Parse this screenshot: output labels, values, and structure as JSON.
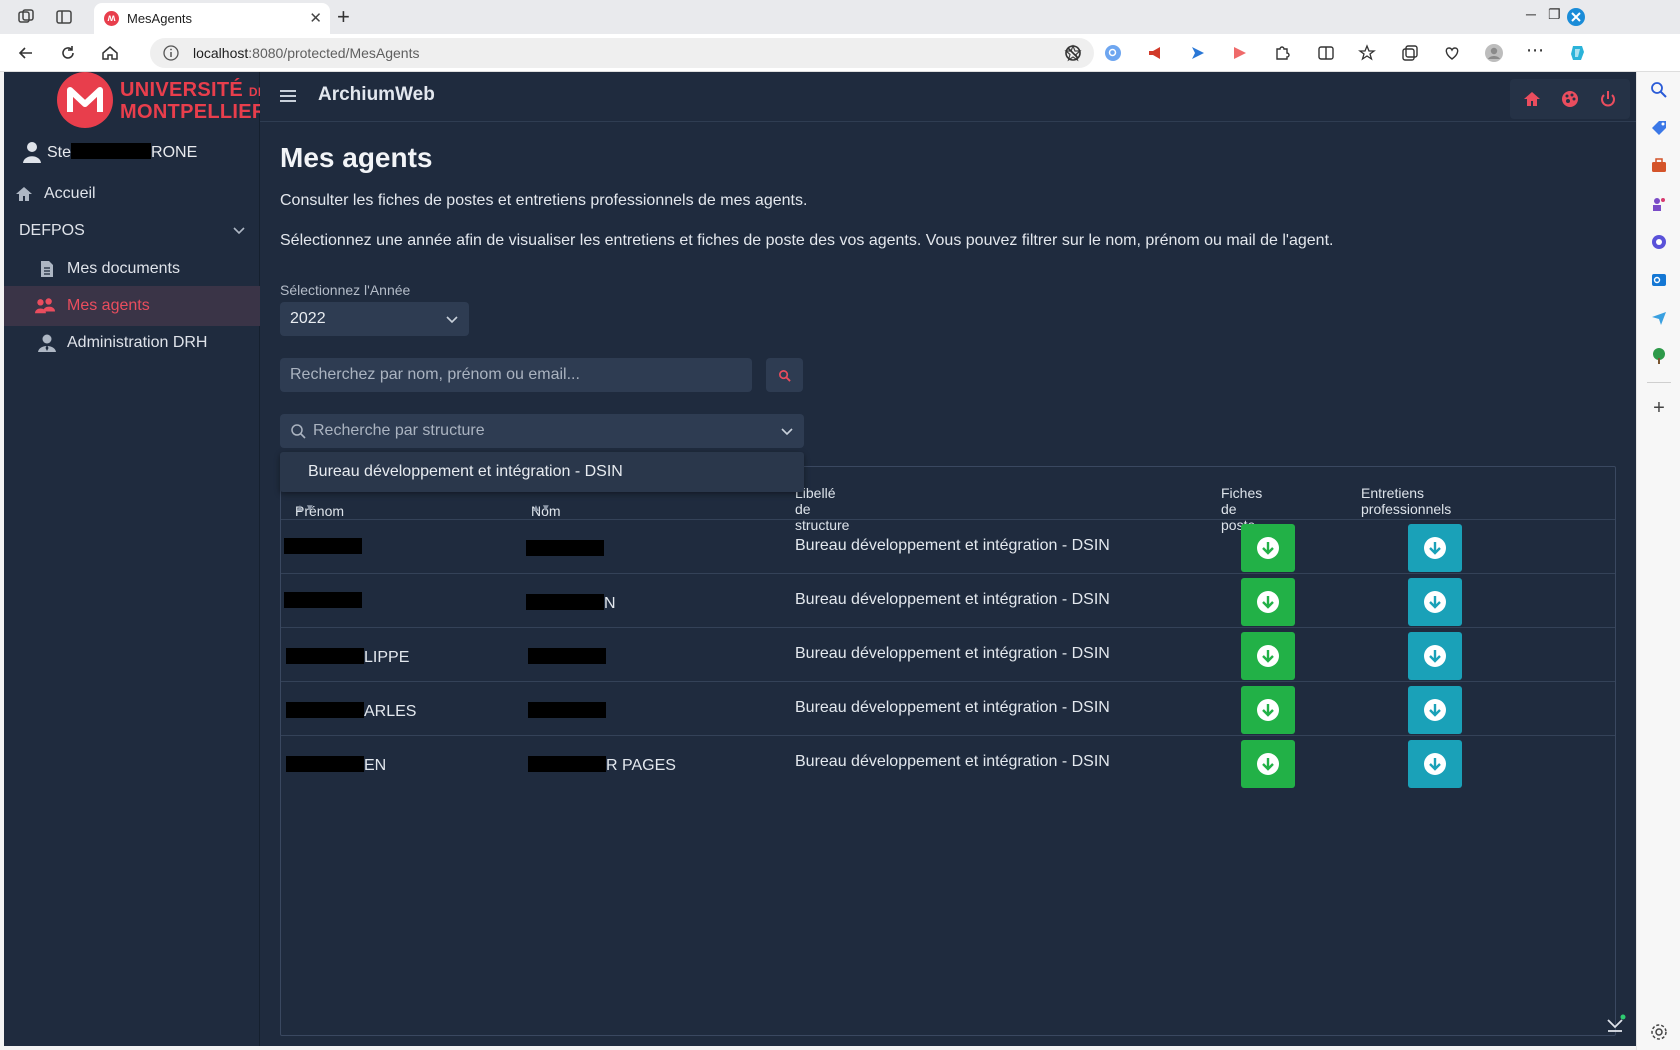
{
  "browser": {
    "tab_title": "MesAgents",
    "tab_favicon": "ʍ",
    "url_host": "localhost",
    "url_rest": ":8080/protected/MesAgents"
  },
  "app": {
    "logo": {
      "line1": "UNIVERSITÉ",
      "line1_suffix": "DE",
      "line2": "MONTPELLIER",
      "mark": "ʍ"
    },
    "user": {
      "name_start": "Ste",
      "name_end": "RONE"
    },
    "sidebar": {
      "home": "Accueil",
      "section": "DEFPOS",
      "items": [
        {
          "label": "Mes documents",
          "icon": "document-icon"
        },
        {
          "label": "Mes agents",
          "icon": "agents-icon",
          "active": true
        },
        {
          "label": "Administration DRH",
          "icon": "admin-user-icon"
        }
      ]
    },
    "topbar": {
      "title": "ArchiumWeb"
    }
  },
  "page": {
    "title": "Mes agents",
    "intro": "Consulter les fiches de postes et entretiens professionnels de mes agents.",
    "instructions": "Sélectionnez une année afin de visualiser les entretiens et fiches de poste des vos agents. Vous pouvez filtrer sur le nom, prénom ou mail de l'agent.",
    "year_label": "Sélectionnez l'Année",
    "year_value": "2022",
    "search_placeholder": "Recherchez par nom, prénom ou email...",
    "structure_placeholder": "Recherche par structure",
    "structure_option": "Bureau développement et intégration - DSIN"
  },
  "table": {
    "headers": {
      "prenom": "Prénom",
      "nom": "Nom",
      "structure": "Libellé de structure",
      "fiches": "Fiches de poste",
      "entretiens": "Entretiens professionnels"
    },
    "rows": [
      {
        "prenom": "",
        "nom": "",
        "structure": "Bureau développement et intégration - DSIN"
      },
      {
        "prenom": "",
        "nom": "N",
        "structure": "Bureau développement et intégration - DSIN"
      },
      {
        "prenom": "LIPPE",
        "nom": "",
        "structure": "Bureau développement et intégration - DSIN"
      },
      {
        "prenom": "ARLES",
        "nom": "",
        "structure": "Bureau développement et intégration - DSIN"
      },
      {
        "prenom": "EN",
        "nom": "R PAGES",
        "structure": "Bureau développement et intégration - DSIN"
      }
    ]
  },
  "colors": {
    "app_bg": "#1f2b3e",
    "accent_red": "#e83e4c",
    "download_green": "#22b147",
    "download_teal": "#1aa1b8"
  }
}
